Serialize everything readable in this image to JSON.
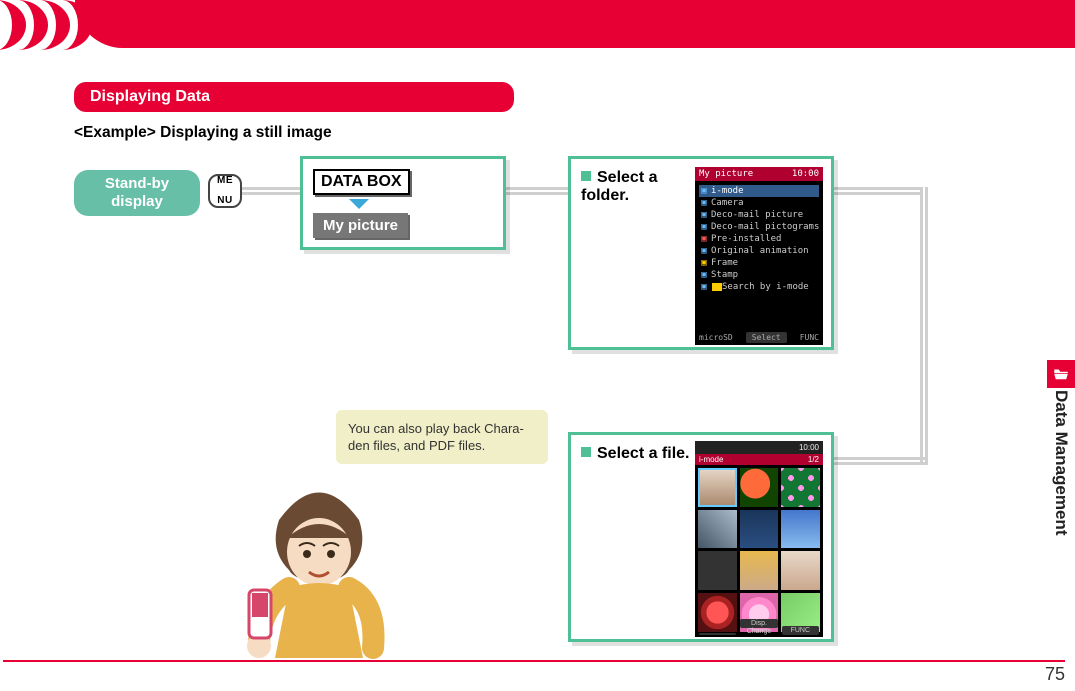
{
  "header": {
    "arcs": 4
  },
  "side_tab": {
    "label": "Data Management"
  },
  "section": {
    "title": "Displaying Data"
  },
  "example_heading": "<Example> Displaying a still image",
  "standby": {
    "line1": "Stand-by",
    "line2": "display"
  },
  "menu_key": {
    "line1": "ME",
    "line2": "NU"
  },
  "databox": {
    "title": "DATA BOX",
    "item": "My picture"
  },
  "step2": {
    "label": "Select a folder.",
    "phone_title": "My picture",
    "phone_time": "10:00",
    "folders": [
      {
        "icon_color": "blue",
        "name": "i-mode",
        "highlight": true
      },
      {
        "icon_color": "blue",
        "name": "Camera"
      },
      {
        "icon_color": "blue",
        "name": "Deco-mail picture"
      },
      {
        "icon_color": "blue",
        "name": "Deco-mail pictograms"
      },
      {
        "icon_color": "red",
        "name": "Pre-installed"
      },
      {
        "icon_color": "blue",
        "name": "Original animation"
      },
      {
        "icon_color": "yellow",
        "name": "Frame"
      },
      {
        "icon_color": "blue",
        "name": "Stamp"
      },
      {
        "icon_color": "blue",
        "name": "Search by i-mode",
        "extra_icon": true
      }
    ],
    "softkeys": {
      "left": "microSD",
      "center": "Select",
      "right": "FUNC"
    }
  },
  "step3": {
    "label": "Select a file.",
    "bar_left": "i-mode",
    "bar_right": "1/2",
    "phone_time": "10:00",
    "softkeys": {
      "left": "",
      "center_top": "Disp.",
      "center_bottom": "Change",
      "right": "FUNC"
    }
  },
  "bubble": {
    "text": "You can also play back Chara-den files, and PDF files."
  },
  "page_number": "75"
}
